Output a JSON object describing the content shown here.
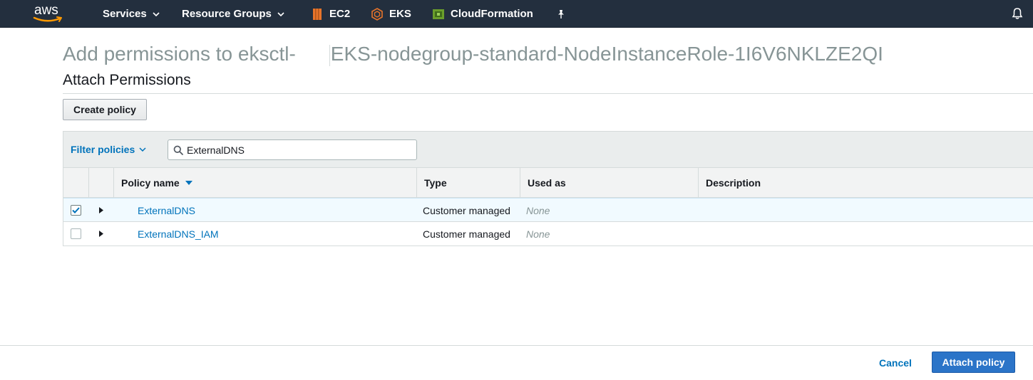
{
  "nav": {
    "logo_text": "aws",
    "services_label": "Services",
    "resource_groups_label": "Resource Groups",
    "pins": [
      {
        "label": "EC2",
        "icon": "ec2-icon",
        "color": "#e7742a"
      },
      {
        "label": "EKS",
        "icon": "eks-icon",
        "color": "#e7742a"
      },
      {
        "label": "CloudFormation",
        "icon": "cloudformation-icon",
        "color": "#6a9e2b"
      }
    ],
    "pin_icon": "pushpin-icon",
    "bell_icon": "bell-icon"
  },
  "page": {
    "title_prefix": "Add permissions to eksctl-",
    "title_suffix": "EKS-nodegroup-standard-NodeInstanceRole-1I6V6NKLZE2QI",
    "section_title": "Attach Permissions",
    "create_policy_label": "Create policy"
  },
  "filter": {
    "label": "Filter policies",
    "search_value": "ExternalDNS"
  },
  "table": {
    "columns": [
      "Policy name",
      "Type",
      "Used as",
      "Description"
    ],
    "rows": [
      {
        "checked": true,
        "name": "ExternalDNS",
        "type": "Customer managed",
        "used_as": "None",
        "description": ""
      },
      {
        "checked": false,
        "name": "ExternalDNS_IAM",
        "type": "Customer managed",
        "used_as": "None",
        "description": ""
      }
    ]
  },
  "footer": {
    "cancel_label": "Cancel",
    "attach_label": "Attach policy"
  },
  "colors": {
    "nav_bg": "#232f3e",
    "link": "#0073bb",
    "primary_button": "#2b74c8",
    "selected_row": "#f1faff"
  }
}
